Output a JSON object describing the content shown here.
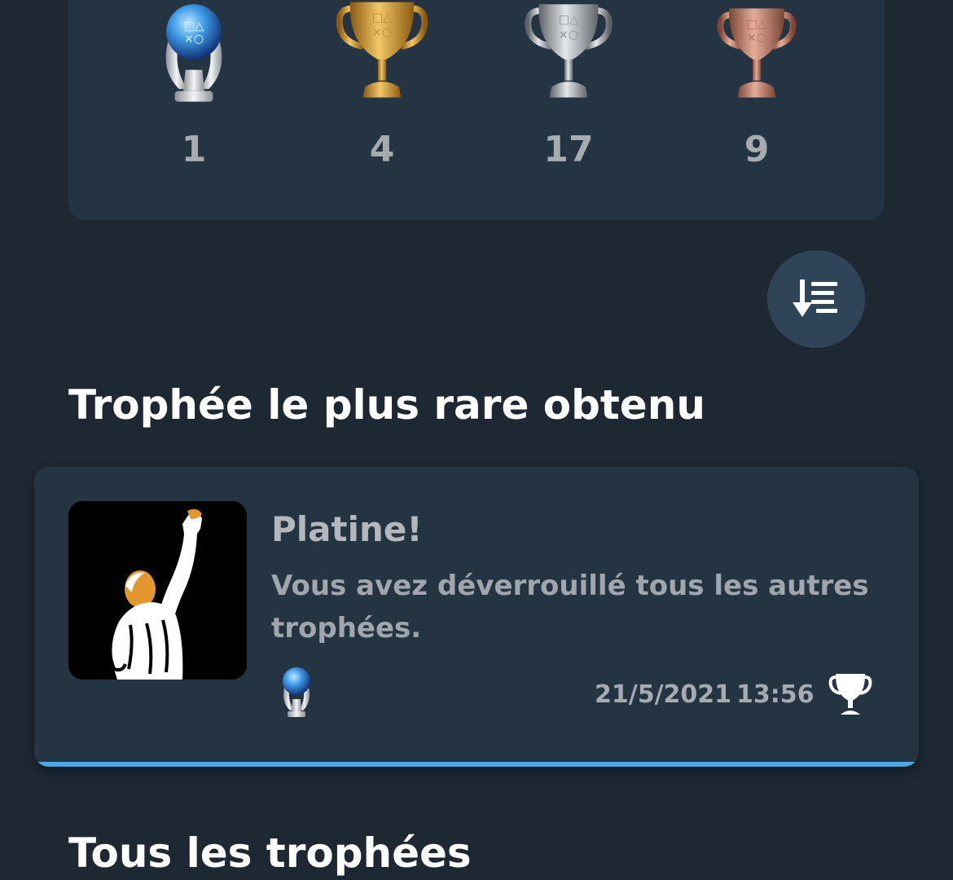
{
  "trophy_summary": {
    "platinum": {
      "count": "1",
      "icon": "platinum-trophy-icon"
    },
    "gold": {
      "count": "4",
      "icon": "gold-trophy-icon"
    },
    "silver": {
      "count": "17",
      "icon": "silver-trophy-icon"
    },
    "bronze": {
      "count": "9",
      "icon": "bronze-trophy-icon"
    }
  },
  "sort_button": {
    "icon": "sort-descending-icon"
  },
  "rarest_section": {
    "title": "Trophée le plus rare obtenu",
    "trophy": {
      "name": "Platine!",
      "description": "Vous avez déverrouillé tous les autres trophées.",
      "grade_icon": "platinum-trophy-icon",
      "date": "21/5/2021",
      "time": "13:56",
      "earned_icon": "trophy-earned-icon"
    }
  },
  "all_trophies_section": {
    "title": "Tous les trophées"
  },
  "colors": {
    "background": "#1d2833",
    "card": "#253443",
    "accent": "#4da7e0",
    "count_text": "#a6abb0",
    "sort_button": "#2f4557"
  }
}
